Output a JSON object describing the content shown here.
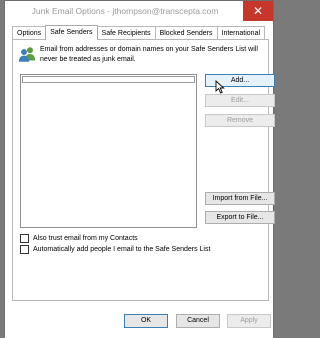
{
  "window": {
    "title": "Junk Email Options - jthompson@transcepta.com",
    "close_glyph": "✕"
  },
  "tabs": [
    {
      "label": "Options",
      "active": false
    },
    {
      "label": "Safe Senders",
      "active": true
    },
    {
      "label": "Safe Recipients",
      "active": false
    },
    {
      "label": "Blocked Senders",
      "active": false
    },
    {
      "label": "International",
      "active": false
    }
  ],
  "panel": {
    "icon": "people-icon",
    "description": "Email from addresses or domain names on your Safe Senders List will never be treated as junk email.",
    "list_items": [
      ""
    ],
    "buttons": {
      "add": "Add...",
      "edit": "Edit...",
      "remove": "Remove",
      "import": "Import from File...",
      "export": "Export to File..."
    },
    "checkboxes": [
      {
        "label": "Also trust email from my Contacts",
        "checked": false
      },
      {
        "label": "Automatically add people I email to the Safe Senders List",
        "checked": false
      }
    ]
  },
  "footer": {
    "ok": "OK",
    "cancel": "Cancel",
    "apply": "Apply"
  },
  "colors": {
    "close_button": "#c7362b",
    "icon_blue": "#3d7fbf",
    "icon_green": "#5c9e3b",
    "hover_border": "#3c7fb1"
  }
}
